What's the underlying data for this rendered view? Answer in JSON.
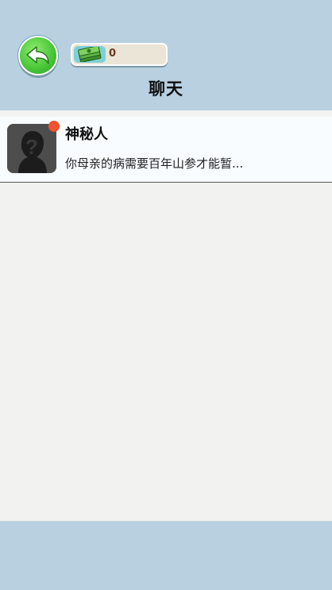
{
  "header": {
    "title": "聊天",
    "money": "0",
    "back_icon": "back-arrow-icon",
    "money_icon": "cash-stack-icon"
  },
  "chats": [
    {
      "name": "神秘人",
      "preview": "你母亲的病需要百年山参才能暂...",
      "avatar_icon": "unknown-person-icon",
      "unread": true
    }
  ],
  "colors": {
    "header_bg": "#b8d0e0",
    "page_bg": "#f2f2f0",
    "badge": "#f0532d",
    "back_button": "#4cc83a"
  }
}
